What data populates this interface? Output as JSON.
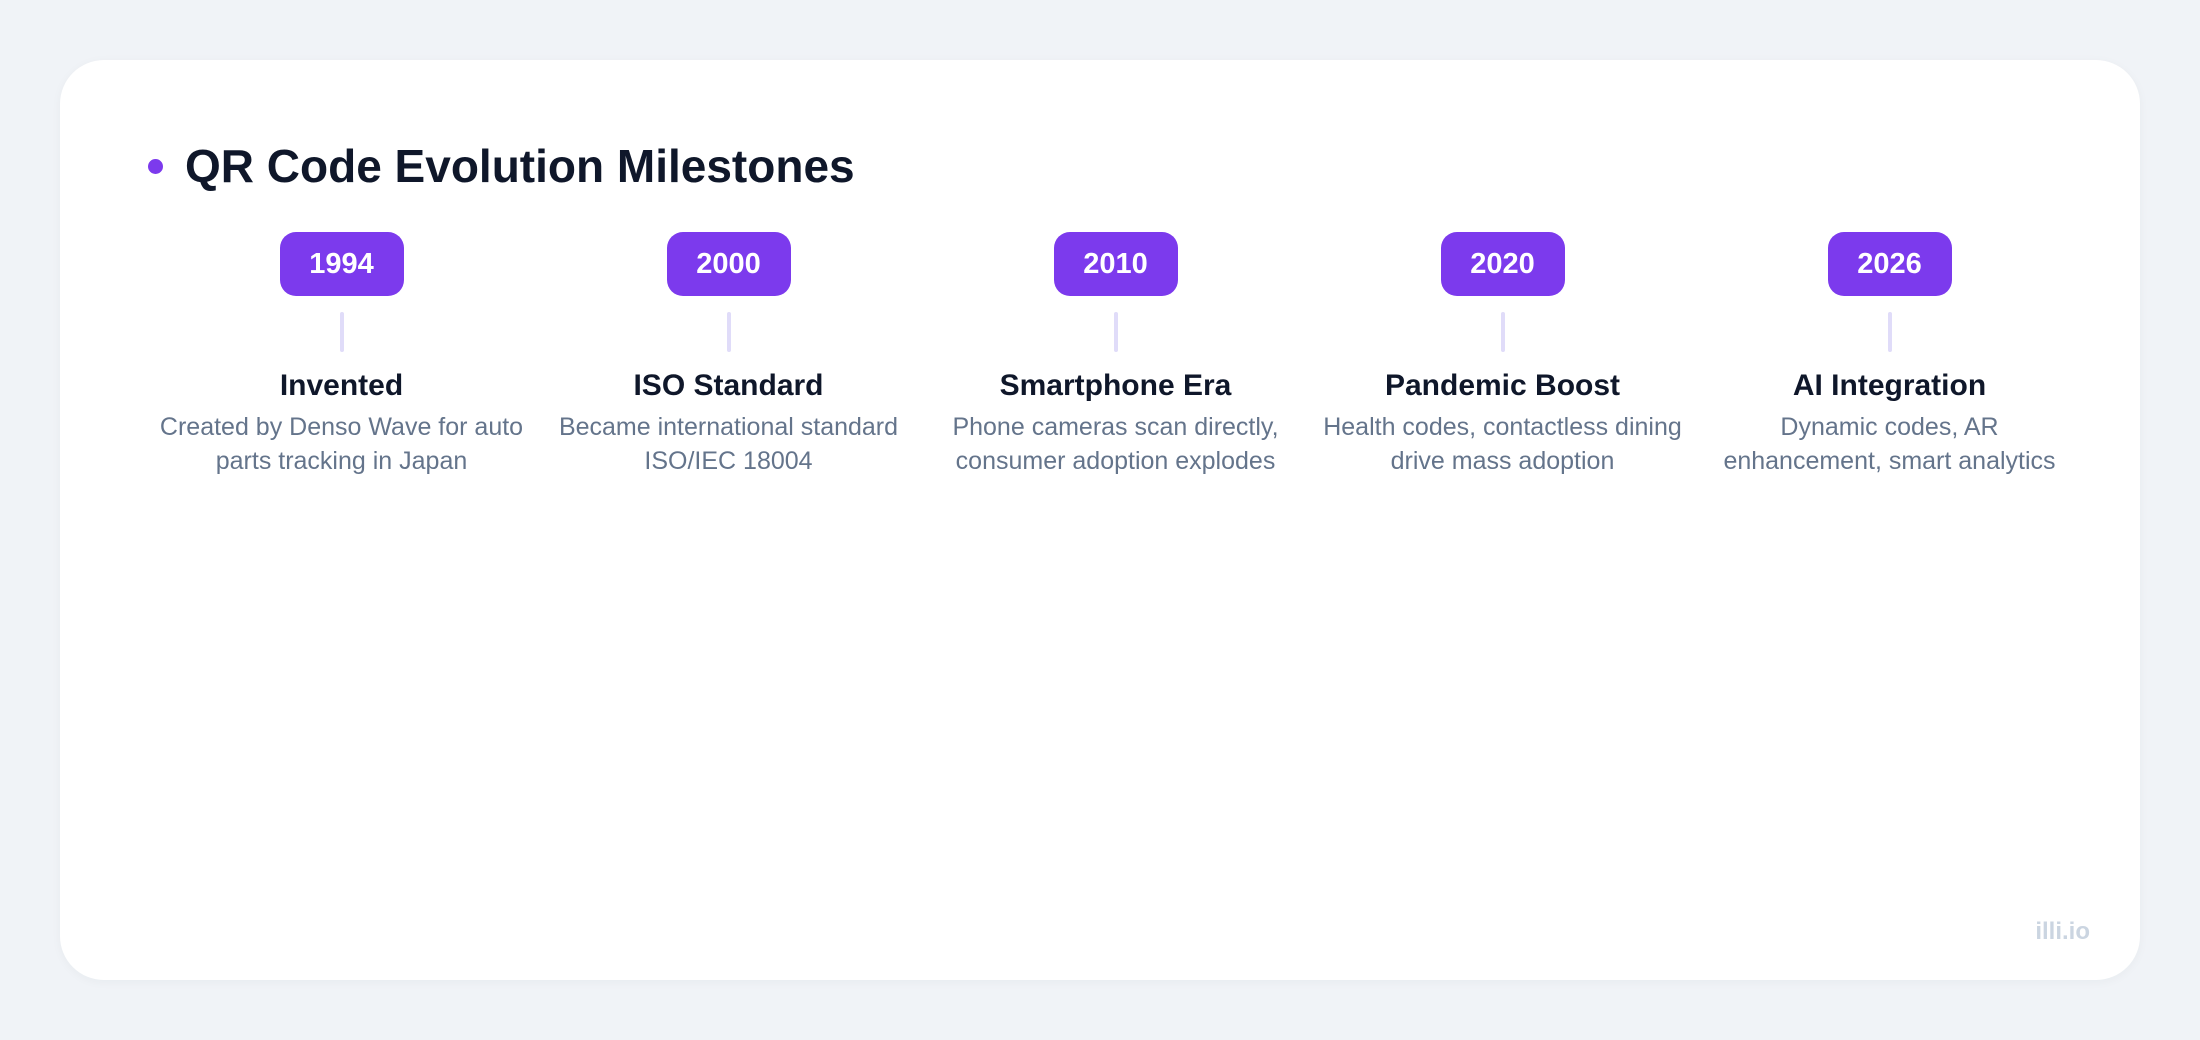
{
  "title": "QR Code Evolution Milestones",
  "accent_color": "#7c3aed",
  "milestones": [
    {
      "year": "1994",
      "title": "Invented",
      "description": "Created by Denso Wave for auto parts tracking in Japan"
    },
    {
      "year": "2000",
      "title": "ISO Standard",
      "description": "Became international standard ISO/IEC 18004"
    },
    {
      "year": "2010",
      "title": "Smartphone Era",
      "description": "Phone cameras scan directly, consumer adoption explodes"
    },
    {
      "year": "2020",
      "title": "Pandemic Boost",
      "description": "Health codes, contactless dining drive mass adoption"
    },
    {
      "year": "2026",
      "title": "AI Integration",
      "description": "Dynamic codes, AR enhancement, smart analytics"
    }
  ],
  "brand": "illi.io"
}
